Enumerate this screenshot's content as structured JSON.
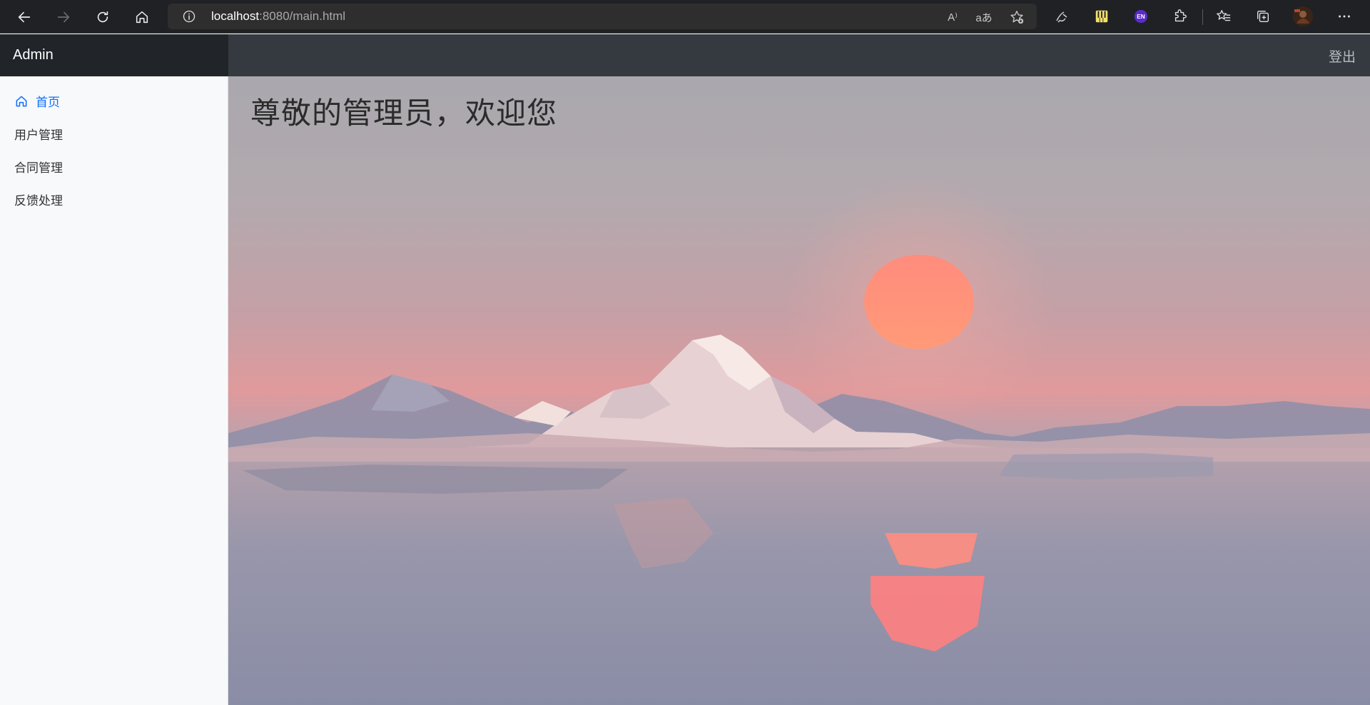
{
  "browser": {
    "url_host": "localhost",
    "url_path": ":8080/main.html",
    "read_aloud_label": "A⁾",
    "translate_label": "aあ",
    "ext_lang_label": "EN"
  },
  "navbar": {
    "brand": "Admin",
    "logout_label": "登出"
  },
  "sidebar": {
    "items": [
      {
        "label": "首页",
        "icon": "home-icon",
        "active": true
      },
      {
        "label": "用户管理"
      },
      {
        "label": "合同管理"
      },
      {
        "label": "反馈处理"
      }
    ]
  },
  "main": {
    "welcome": "尊敬的管理员，欢迎您"
  },
  "colors": {
    "active_link": "#0d6efd",
    "navbar_brand_bg": "#212529",
    "navbar_bg": "#343a40",
    "sun": "#ff8a78"
  }
}
